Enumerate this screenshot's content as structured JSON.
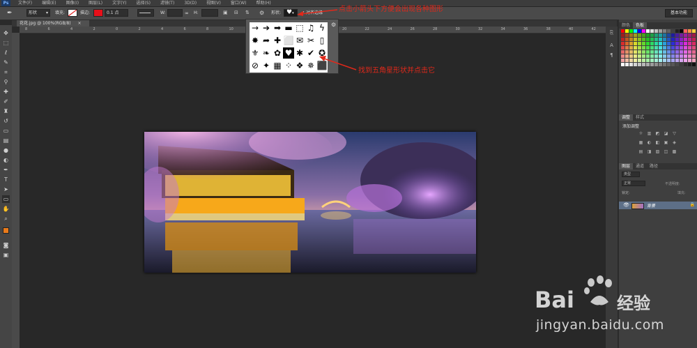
{
  "menubar": {
    "app_badge": "Ps",
    "items": [
      "文件(F)",
      "编辑(E)",
      "图像(I)",
      "图层(L)",
      "文字(Y)",
      "选择(S)",
      "滤镜(T)",
      "3D(D)",
      "视图(V)",
      "窗口(W)",
      "帮助(H)"
    ]
  },
  "options": {
    "mode_value": "形状",
    "fill_label": "填充:",
    "stroke_label": "描边:",
    "stroke_width": "0.1 点",
    "w_label": "W:",
    "h_label": "H:",
    "shape_label": "形状:",
    "align_edges_label": "对齐边缘",
    "workspace_button": "基本功能"
  },
  "document": {
    "tab_label": "花花.jpg @ 100%(RGB/8)",
    "close_glyph": "×"
  },
  "ruler": {
    "ticks": [
      "8",
      "6",
      "4",
      "2",
      "0",
      "2",
      "4",
      "6",
      "8",
      "10",
      "12",
      "14",
      "16",
      "18",
      "20",
      "22",
      "24",
      "26",
      "28",
      "30",
      "32",
      "34",
      "36",
      "38",
      "40",
      "42"
    ]
  },
  "shape_picker": {
    "shapes": [
      "→",
      "➔",
      "➡",
      "▬",
      "⬚",
      "♫",
      "ϟ",
      "✸",
      "➦",
      "✚",
      "⬜",
      "✉",
      "✂",
      "▯",
      "⚜",
      "❧",
      "✿",
      "♥",
      "✱",
      "✔",
      "✪",
      "⊘",
      "✦",
      "▦",
      "⁘",
      "❖",
      "✵",
      "⬛"
    ],
    "selected_index": 17
  },
  "annotations": {
    "top": "点击小箭头下方便会出现各种图形",
    "middle": "找到五角星形状并点击它"
  },
  "panels": {
    "color_tabs": [
      "颜色",
      "色板"
    ],
    "adjust_tabs": [
      "调整",
      "样式"
    ],
    "adjust_title": "添加调整",
    "layer_tabs": [
      "图层",
      "通道",
      "路径"
    ],
    "layer_kind": "类型",
    "blend_mode": "正常",
    "opacity_label": "不透明度:",
    "lock_label": "锁定:",
    "fill_label": "填充:",
    "layer_name": "背景"
  },
  "watermark": {
    "brand_text": "Bai",
    "brand_cn": "经验",
    "url": "jingyan.baidu.com"
  }
}
